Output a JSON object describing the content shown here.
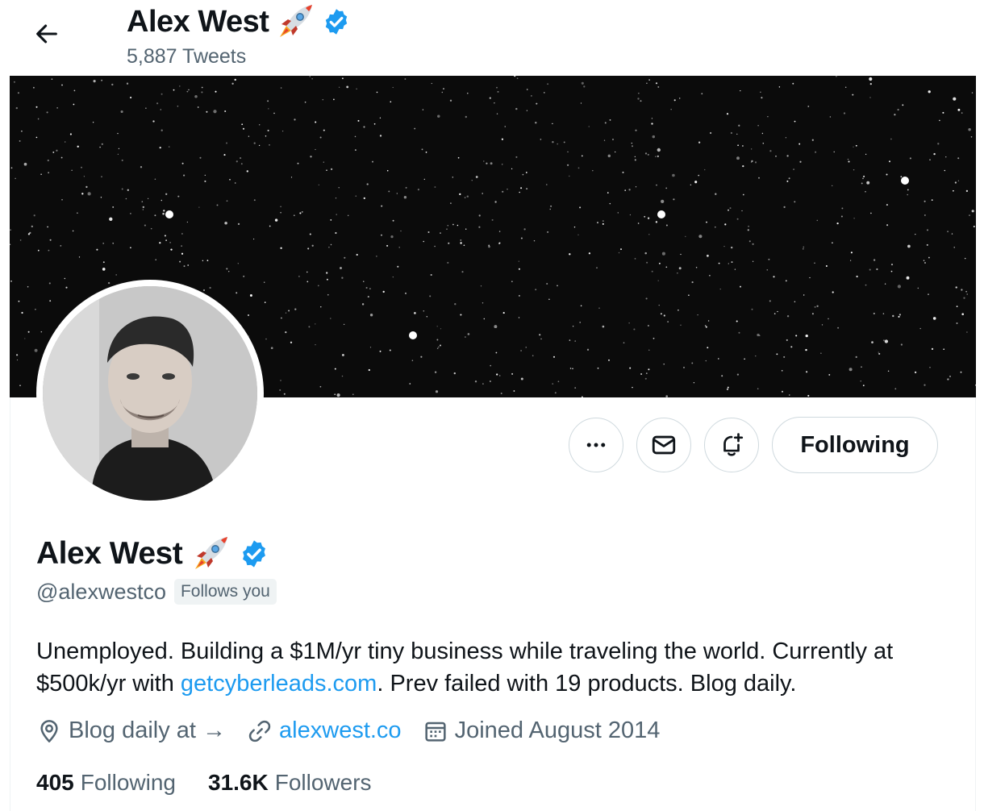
{
  "header": {
    "name": "Alex West",
    "tweet_count": "5,887 Tweets"
  },
  "profile": {
    "name": "Alex West",
    "handle": "@alexwestco",
    "follows_you": "Follows you",
    "bio_part1": "Unemployed. Building a $1M/yr tiny business while traveling the world. Currently at $500k/yr with ",
    "bio_link": "getcyberleads.com",
    "bio_part2": ". Prev failed with 19 products. Blog daily.",
    "location": "Blog daily at →",
    "website": "alexwest.co",
    "joined": "Joined August 2014",
    "following_count": "405",
    "following_label": "Following",
    "followers_count": "31.6K",
    "followers_label": "Followers"
  },
  "actions": {
    "follow_state_label": "Following"
  },
  "icons": {
    "back": "arrow-left-icon",
    "more": "more-icon",
    "message": "envelope-icon",
    "notify": "bell-plus-icon",
    "location": "location-pin-icon",
    "link": "link-icon",
    "calendar": "calendar-icon",
    "verified": "verified-badge-icon",
    "rocket": "rocket-emoji"
  },
  "colors": {
    "accent": "#1d9bf0",
    "secondary_text": "#536471",
    "primary_text": "#0f1419",
    "border": "#cfd9de"
  }
}
